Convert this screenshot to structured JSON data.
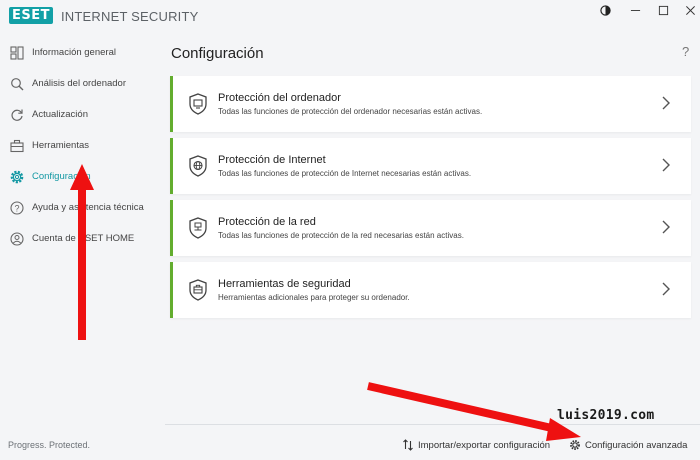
{
  "app": {
    "logo_text": "eset",
    "title": "INTERNET SECURITY",
    "accent_color": "#12a0a6",
    "card_accent_color": "#63ad2f"
  },
  "window_controls": {
    "theme_icon": "half-circle-icon",
    "minimize_icon": "minimize-icon",
    "maximize_icon": "maximize-icon",
    "close_icon": "close-icon"
  },
  "sidebar": {
    "items": [
      {
        "label": "Información general",
        "icon": "overview-icon"
      },
      {
        "label": "Análisis del ordenador",
        "icon": "scan-icon"
      },
      {
        "label": "Actualización",
        "icon": "update-icon"
      },
      {
        "label": "Herramientas",
        "icon": "tools-icon"
      },
      {
        "label": "Configuración",
        "icon": "gear-icon",
        "active": true
      },
      {
        "label": "Ayuda y asistencia técnica",
        "icon": "help-icon"
      },
      {
        "label": "Cuenta de ESET HOME",
        "icon": "account-icon"
      }
    ],
    "status": "Progress. Protected."
  },
  "main": {
    "title": "Configuración",
    "help": "?",
    "cards": [
      {
        "title": "Protección del ordenador",
        "desc": "Todas las funciones de protección del ordenador necesarias están activas.",
        "icon": "computer-shield-icon"
      },
      {
        "title": "Protección de Internet",
        "desc": "Todas las funciones de protección de Internet necesarias están activas.",
        "icon": "globe-shield-icon"
      },
      {
        "title": "Protección de la red",
        "desc": "Todas las funciones de protección de la red necesarias están activas.",
        "icon": "network-shield-icon"
      },
      {
        "title": "Herramientas de seguridad",
        "desc": "Herramientas adicionales para proteger su ordenador.",
        "icon": "toolbox-shield-icon"
      }
    ]
  },
  "footer": {
    "import_export": "Importar/exportar configuración",
    "advanced": "Configuración avanzada"
  },
  "watermark": "luis2019.com"
}
